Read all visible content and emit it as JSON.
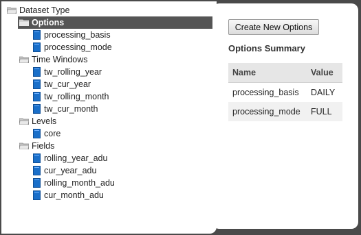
{
  "tree": {
    "root": "Dataset Type",
    "groups": [
      {
        "label": "Options",
        "items": [
          "processing_basis",
          "processing_mode"
        ]
      },
      {
        "label": "Time Windows",
        "items": [
          "tw_rolling_year",
          "tw_cur_year",
          "tw_rolling_month",
          "tw_cur_month"
        ]
      },
      {
        "label": "Levels",
        "items": [
          "core"
        ]
      },
      {
        "label": "Fields",
        "items": [
          "rolling_year_adu",
          "cur_year_adu",
          "rolling_month_adu",
          "cur_month_adu"
        ]
      }
    ]
  },
  "right": {
    "create_button": "Create New Options",
    "summary_title": "Options Summary",
    "table": {
      "columns": [
        "Name",
        "Value"
      ],
      "rows": [
        [
          "processing_basis",
          "DAILY"
        ],
        [
          "processing_mode",
          "FULL"
        ]
      ]
    }
  },
  "colors": {
    "background": "#4a4a4a",
    "selected": "#555555",
    "doc_icon": "#1a6fc9"
  }
}
